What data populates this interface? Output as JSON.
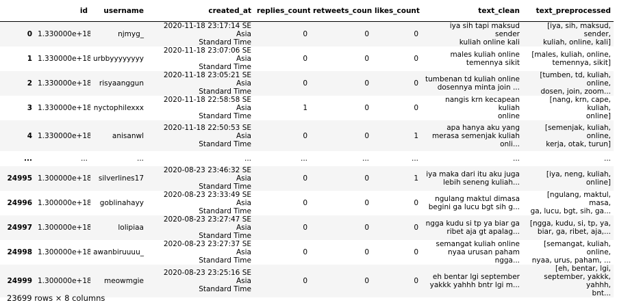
{
  "columns": [
    "",
    "id",
    "username",
    "created_at",
    "replies_count",
    "retweets_count",
    "likes_count",
    "text_clean",
    "text_preprocessed"
  ],
  "rows": [
    {
      "idx": "0",
      "id": "1.330000e+18",
      "username": "njmyg_",
      "created_at": [
        "2020-11-18 23:17:14 SE Asia",
        "Standard Time"
      ],
      "replies": "0",
      "retweets": "0",
      "likes": "0",
      "text_clean": [
        "iya sih tapi maksud sender",
        "kuliah online kali"
      ],
      "text_pre": [
        "[iya, sih, maksud, sender,",
        "kuliah, online, kali]"
      ]
    },
    {
      "idx": "1",
      "id": "1.330000e+18",
      "username": "urbbyyyyyyyy",
      "created_at": [
        "2020-11-18 23:07:06 SE Asia",
        "Standard Time"
      ],
      "replies": "0",
      "retweets": "0",
      "likes": "0",
      "text_clean": [
        "males kuliah online",
        "temennya sikit"
      ],
      "text_pre": [
        "[males, kuliah, online,",
        "temennya, sikit]"
      ]
    },
    {
      "idx": "2",
      "id": "1.330000e+18",
      "username": "risyaanggun",
      "created_at": [
        "2020-11-18 23:05:21 SE Asia",
        "Standard Time"
      ],
      "replies": "0",
      "retweets": "0",
      "likes": "0",
      "text_clean": [
        "tumbenan td kuliah online",
        "dosennya minta join ..."
      ],
      "text_pre": [
        "[tumben, td, kuliah, online,",
        "dosen, join, zoom..."
      ]
    },
    {
      "idx": "3",
      "id": "1.330000e+18",
      "username": "nyctophilexxx",
      "created_at": [
        "2020-11-18 22:58:58 SE Asia",
        "Standard Time"
      ],
      "replies": "1",
      "retweets": "0",
      "likes": "0",
      "text_clean": [
        "nangis krn kecapean kuliah",
        "online"
      ],
      "text_pre": [
        "[nang, krn, cape, kuliah,",
        "online]"
      ]
    },
    {
      "idx": "4",
      "id": "1.330000e+18",
      "username": "anisanwl",
      "created_at": [
        "2020-11-18 22:50:53 SE Asia",
        "Standard Time"
      ],
      "replies": "0",
      "retweets": "0",
      "likes": "1",
      "text_clean": [
        "apa hanya aku yang",
        "merasa semenjak kuliah",
        "onli..."
      ],
      "text_pre": [
        "[semenjak, kuliah, online,",
        "kerja, otak, turun]"
      ]
    },
    {
      "idx": "...",
      "id": "...",
      "username": "...",
      "created_at": [
        "..."
      ],
      "replies": "...",
      "retweets": "...",
      "likes": "...",
      "text_clean": [
        "..."
      ],
      "text_pre": [
        "..."
      ]
    },
    {
      "idx": "24995",
      "id": "1.300000e+18",
      "username": "silverlines17",
      "created_at": [
        "2020-08-23 23:46:32 SE Asia",
        "Standard Time"
      ],
      "replies": "0",
      "retweets": "0",
      "likes": "1",
      "text_clean": [
        "iya maka dari itu aku juga",
        "lebih seneng kuliah..."
      ],
      "text_pre": [
        "[iya, neng, kuliah, online]"
      ]
    },
    {
      "idx": "24996",
      "id": "1.300000e+18",
      "username": "goblinahayy",
      "created_at": [
        "2020-08-23 23:33:49 SE Asia",
        "Standard Time"
      ],
      "replies": "0",
      "retweets": "0",
      "likes": "0",
      "text_clean": [
        "ngulang maktul dimasa",
        "begini ga lucu bgt sih g..."
      ],
      "text_pre": [
        "[ngulang, maktul, masa,",
        "ga, lucu, bgt, sih, ga..."
      ]
    },
    {
      "idx": "24997",
      "id": "1.300000e+18",
      "username": "lolipiaa",
      "created_at": [
        "2020-08-23 23:27:47 SE Asia",
        "Standard Time"
      ],
      "replies": "0",
      "retweets": "0",
      "likes": "0",
      "text_clean": [
        "ngga kudu si tp ya biar ga",
        "ribet aja gt apalag..."
      ],
      "text_pre": [
        "[ngga, kudu, si, tp, ya,",
        "biar, ga, ribet, aja,..."
      ]
    },
    {
      "idx": "24998",
      "id": "1.300000e+18",
      "username": "awanbiruuuu_",
      "created_at": [
        "2020-08-23 23:27:37 SE Asia",
        "Standard Time"
      ],
      "replies": "0",
      "retweets": "0",
      "likes": "0",
      "text_clean": [
        "semangat kuliah online",
        "nyaa urusan paham ngga..."
      ],
      "text_pre": [
        "[semangat, kuliah, online,",
        "nyaa, urus, paham, ..."
      ]
    },
    {
      "idx": "24999",
      "id": "1.300000e+18",
      "username": "meowmgie",
      "created_at": [
        "2020-08-23 23:25:16 SE Asia",
        "Standard Time"
      ],
      "replies": "0",
      "retweets": "0",
      "likes": "0",
      "text_clean": [
        "eh bentar lgi september",
        "yakkk yahhh bntr lgi m..."
      ],
      "text_pre": [
        "[eh, bentar, lgi,",
        "september, yakkk, yahhh,",
        "bnt..."
      ]
    }
  ],
  "footer": "23699 rows × 8 columns"
}
